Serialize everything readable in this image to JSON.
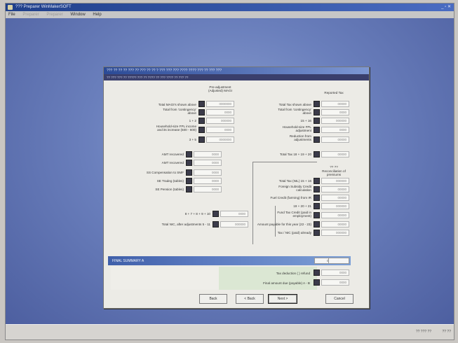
{
  "window": {
    "title": "??? Preparer  WinMakerSOFT",
    "controls": "_ ▫ ✕",
    "menu": [
      "File",
      "Preparer",
      "Preparer",
      "Window",
      "Help"
    ]
  },
  "taskbar": {
    "tray_items": [
      "?? ??? ??",
      "?? ??"
    ]
  },
  "dialog": {
    "title": "??? ?? ?? ?? ??? ?? ??? ?? ?? ? ??? ??? ??? ???? ???? ??? ?? ??? ???",
    "subtitle": "?? ??? ??? ?? ????? ??? ?? ???? ?? ??? ???? ?? ??? ??"
  },
  "headers": {
    "left_col": "Pre-adjustment (Adjusted) MAGI",
    "right_col": "Reported Tax",
    "right_small": "??  ??",
    "right_note": "Reconciliation of premiums"
  },
  "left_rows": [
    {
      "label": "Total MAGI's shown above",
      "value": "0000000"
    },
    {
      "label": "Total from 'contingency' above",
      "value": "0000"
    },
    {
      "label": "1 + 2",
      "value": "000000"
    },
    {
      "label": "Household-size FPL income and its increase  (500 - 600)",
      "value": "0000"
    },
    {
      "label": "3 + 5",
      "value": "0000000"
    }
  ],
  "right_rows": [
    {
      "label": "Total Tax shown above",
      "value": "00000"
    },
    {
      "label": "Total from 'contingency' above",
      "value": "0000"
    },
    {
      "label": "15 + 16",
      "value": "000000"
    },
    {
      "label": "Household-size FPL adjustment",
      "value": "0000"
    },
    {
      "label": "Reduction from adjustments",
      "value": "00000"
    }
  ],
  "total_row": {
    "label": "Total Tax  18 + 19 + 20",
    "value": "00000"
  },
  "mid_rows": [
    {
      "label": "AMT recovered",
      "value": "0000"
    },
    {
      "label": "AMT recovered",
      "value": "0000"
    },
    {
      "label": "SS Compensation to SMF",
      "value": "0000"
    },
    {
      "label": "SE Tradeg (tables)",
      "value": "0000"
    },
    {
      "label": "SE Pension (tables)",
      "value": "0000"
    }
  ],
  "right_lower_rows": [
    {
      "label": "Total Tax (NIL)   15 + 16",
      "value": "000000"
    },
    {
      "label": "Foreign Subsidy Credit calculation",
      "value": "00000"
    },
    {
      "label": "Fuel Credit (farming) from IR",
      "value": "00000"
    },
    {
      "label": "19 + 20 + 21",
      "value": "000000"
    },
    {
      "label": "Fund Tax Credit (paid in employment)",
      "value": "00000"
    },
    {
      "label": "Amount payable for this year (22 - 23)",
      "value": "00000"
    },
    {
      "label": "Tax / NIC (paid) already",
      "value": "000000"
    }
  ],
  "sum_rows": [
    {
      "label": "8 + 7 + 8 + 9 + 10",
      "value": "0000"
    },
    {
      "label": "Total NIC, after adjustments   5 - 11",
      "value": "000000"
    }
  ],
  "band": {
    "label": "FINAL SUMMARY A",
    "value": "00"
  },
  "bottom_rows": [
    {
      "label": "Tax deduction (   ) refund",
      "value": "0000"
    },
    {
      "label": "Final amount due (payable)  A - B",
      "value": "0000"
    }
  ],
  "buttons": {
    "back": "Back",
    "prev": "< Back",
    "next": "Next >",
    "cancel": "Cancel"
  }
}
